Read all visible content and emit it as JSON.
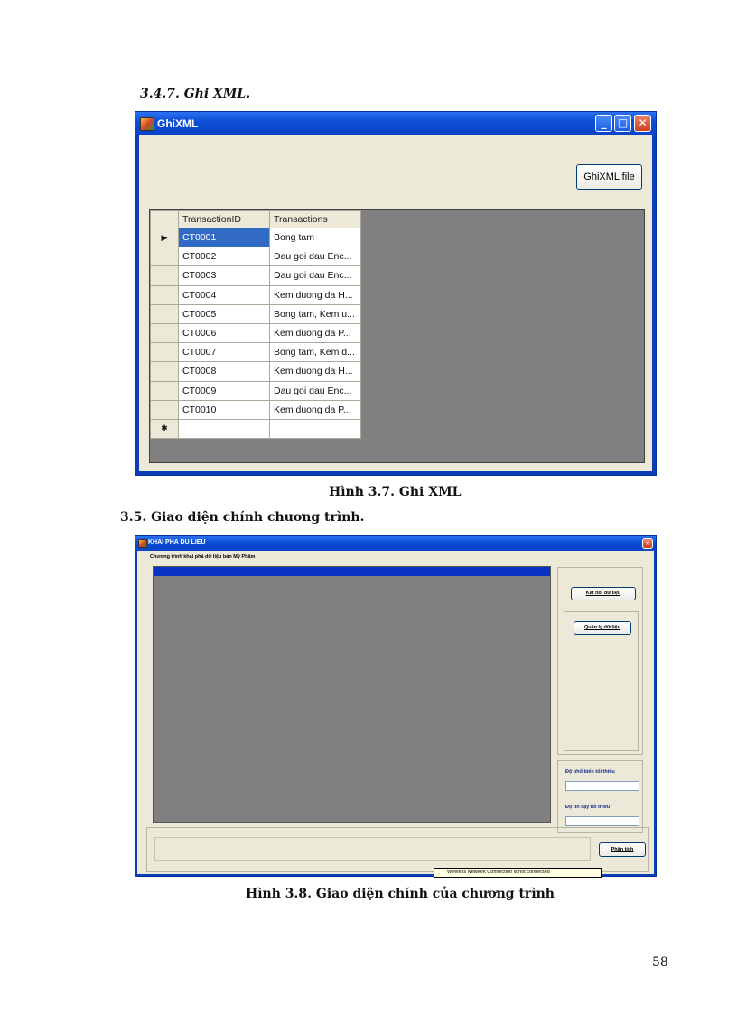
{
  "headings": {
    "section_347": "3.4.7. Ghi XML.",
    "section_35": "3.5. Giao diện chính chương trình."
  },
  "captions": {
    "fig37": "Hình 3.7. Ghi XML",
    "fig38": "Hình 3.8. Giao diện chính của chương trình"
  },
  "page_number": "58",
  "ghixml_window": {
    "title": "GhiXML",
    "button_label": "GhiXML file",
    "columns": [
      "TransactionID",
      "Transactions"
    ],
    "rows": [
      {
        "id": "CT0001",
        "tx": "Bong tam"
      },
      {
        "id": "CT0002",
        "tx": "Dau goi dau Enc..."
      },
      {
        "id": "CT0003",
        "tx": "Dau goi dau Enc..."
      },
      {
        "id": "CT0004",
        "tx": "Kem duong da H..."
      },
      {
        "id": "CT0005",
        "tx": "Bong tam, Kem u..."
      },
      {
        "id": "CT0006",
        "tx": "Kem duong da P..."
      },
      {
        "id": "CT0007",
        "tx": "Bong tam, Kem d..."
      },
      {
        "id": "CT0008",
        "tx": "Kem duong da H..."
      },
      {
        "id": "CT0009",
        "tx": "Dau goi dau Enc..."
      },
      {
        "id": "CT0010",
        "tx": "Kem duong da P..."
      }
    ],
    "current_row_marker": "▶",
    "new_row_marker": "✱"
  },
  "main_window": {
    "title": "KHAI PHA DU LIEU",
    "subtitle": "Chương trình khai phá dữ liệu bán Mỹ Phẩm",
    "connect_button": "Kết nối dữ liệu",
    "manage_button": "Quản lý dữ liệu",
    "min_support_label": "Độ phổ biến tối thiểu",
    "min_confidence_label": "Độ tin cậy tối thiểu",
    "analyze_button": "Phân tích",
    "notification": "Wireless Network Connection is not connected"
  }
}
